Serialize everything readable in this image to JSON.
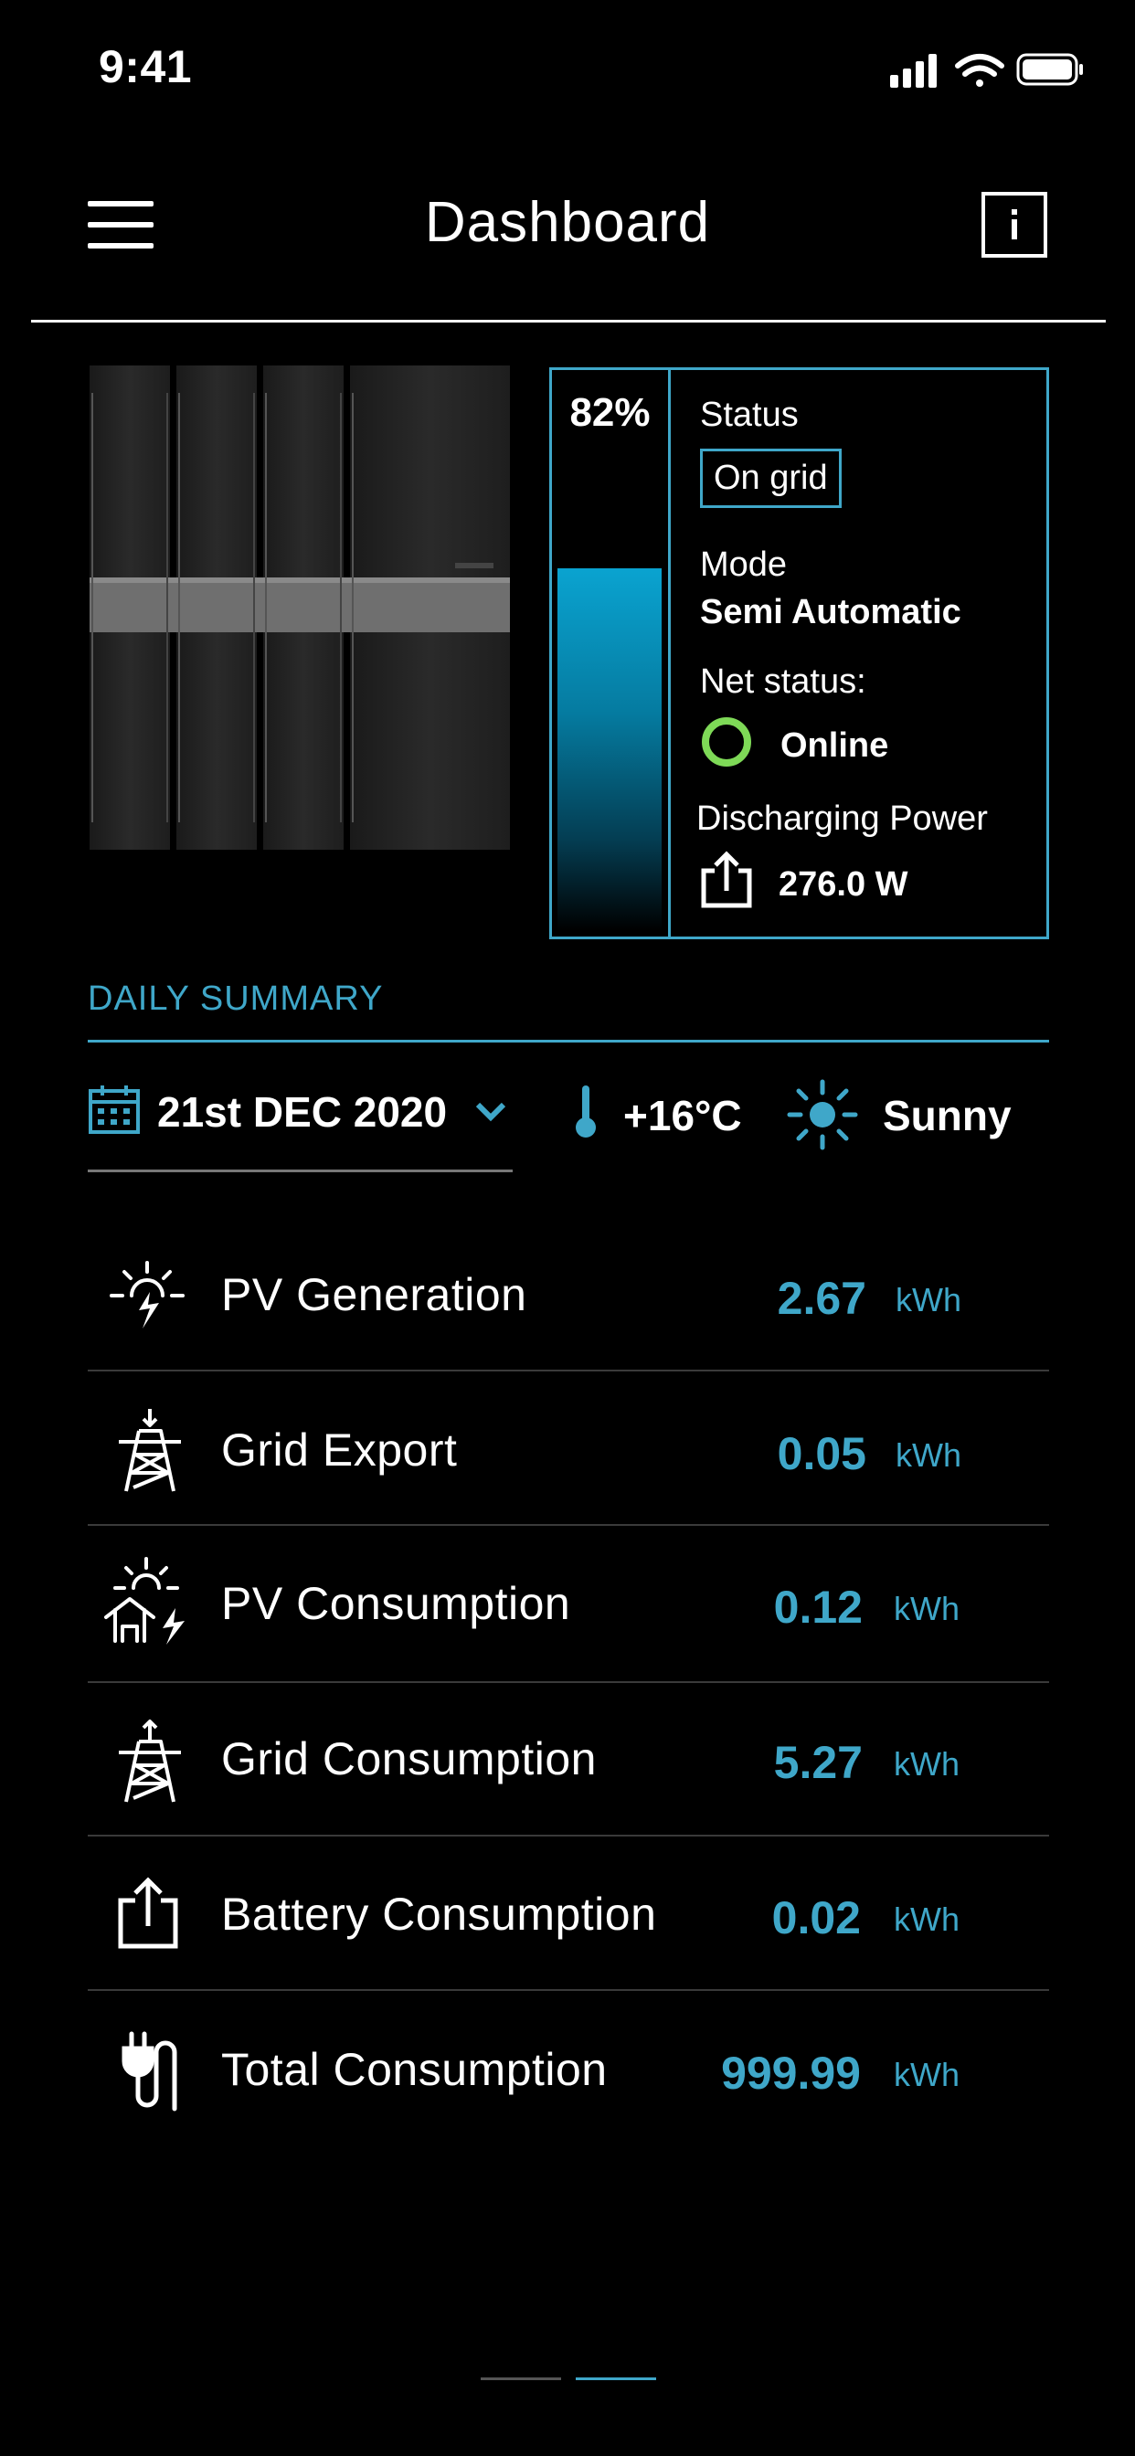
{
  "status_bar": {
    "time": "9:41"
  },
  "header": {
    "title": "Dashboard"
  },
  "battery": {
    "charge_percent_label": "82%",
    "charge_level": 0.82,
    "status_label": "Status",
    "status_value": "On grid",
    "mode_label": "Mode",
    "mode_value": "Semi Automatic",
    "net_status_label": "Net status:",
    "net_status_value": "Online",
    "discharging_label": "Discharging Power",
    "discharging_value": "276.0 W"
  },
  "daily_summary": {
    "title": "DAILY SUMMARY",
    "date": "21st DEC 2020",
    "temperature": "+16°C",
    "weather": "Sunny",
    "rows": [
      {
        "label": "PV Generation",
        "value": "2.67",
        "unit": "kWh",
        "icon": "solar-bolt-icon"
      },
      {
        "label": "Grid Export",
        "value": "0.05",
        "unit": "kWh",
        "icon": "pylon-down-icon"
      },
      {
        "label": "PV Consumption",
        "value": "0.12",
        "unit": "kWh",
        "icon": "solar-house-icon"
      },
      {
        "label": "Grid Consumption",
        "value": "5.27",
        "unit": "kWh",
        "icon": "pylon-up-icon"
      },
      {
        "label": "Battery Consumption",
        "value": "0.02",
        "unit": "kWh",
        "icon": "export-icon"
      },
      {
        "label": "Total Consumption",
        "value": "999.99",
        "unit": "kWh",
        "icon": "plug-icon"
      }
    ]
  },
  "colors": {
    "accent": "#3fa7c9",
    "online": "#7ed957",
    "background": "#000000"
  }
}
